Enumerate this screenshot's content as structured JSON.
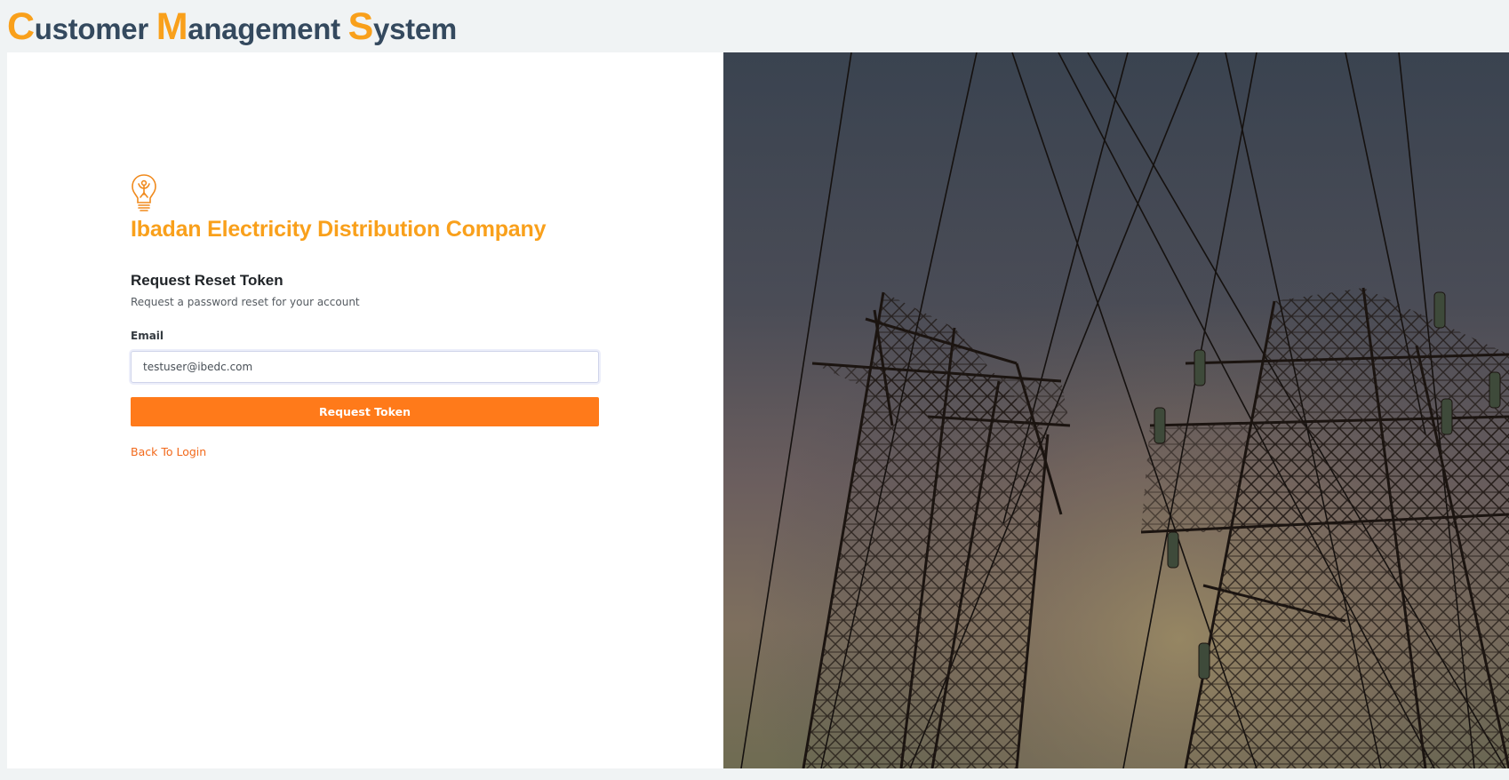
{
  "header": {
    "title_parts": [
      {
        "cap": "C",
        "rest": "ustomer "
      },
      {
        "cap": "M",
        "rest": "anagement "
      },
      {
        "cap": "S",
        "rest": "ystem"
      }
    ]
  },
  "brand": {
    "logo_icon": "lightbulb-person-icon",
    "company_name": "Ibadan Electricity Distribution Company",
    "accent_color": "#f9a01b"
  },
  "form": {
    "title": "Request Reset Token",
    "subtitle": "Request a password reset for your account",
    "email_label": "Email",
    "email_value": "testuser@ibedc.com",
    "submit_label": "Request Token",
    "back_link_label": "Back To Login",
    "button_color": "#ff7a1a"
  },
  "hero": {
    "image_subject": "electricity-pylons-sunset-photo"
  }
}
